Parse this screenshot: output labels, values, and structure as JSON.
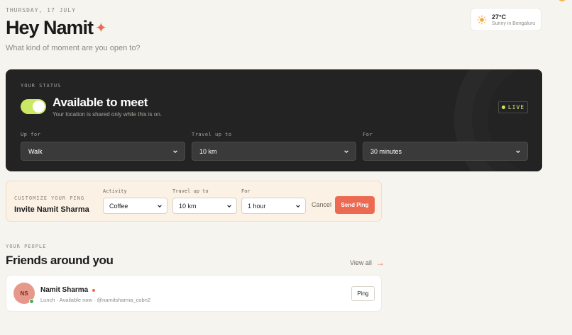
{
  "header": {
    "date": "THURSDAY, 17 JULY",
    "greeting": "Hey Namit",
    "subtitle": "What kind of moment are you open to?"
  },
  "weather": {
    "temperature": "27°C",
    "condition": "Sunny in Bengaluru",
    "icon": "sun-icon"
  },
  "status": {
    "section_label": "YOUR STATUS",
    "toggle_on": true,
    "title": "Available to meet",
    "subtitle": "Your location is shared only while this is on.",
    "live_label": "LIVE",
    "fields": {
      "up_for": {
        "label": "Up for",
        "value": "Walk"
      },
      "travel": {
        "label": "Travel up to",
        "value": "10 km"
      },
      "for": {
        "label": "For",
        "value": "30 minutes"
      }
    }
  },
  "ping": {
    "kicker": "CUSTOMIZE YOUR PING",
    "title": "Invite Namit Sharma",
    "activity": {
      "label": "Activity",
      "value": "Coffee"
    },
    "travel": {
      "label": "Travel up to",
      "value": "10 km"
    },
    "for": {
      "label": "For",
      "value": "1 hour"
    },
    "cancel_label": "Cancel",
    "send_label": "Send Ping"
  },
  "people": {
    "kicker": "YOUR PEOPLE",
    "title": "Friends around you",
    "view_all": "View all",
    "friends": [
      {
        "initials": "NS",
        "name": "Namit Sharma",
        "meta": "Lunch · Available now · @namitsharma_cobn2",
        "ping_label": "Ping"
      }
    ]
  },
  "colors": {
    "background": "#f6f4ef",
    "accent": "#ec6a52",
    "toggle": "#cbe863",
    "card_dark": "#232323"
  }
}
